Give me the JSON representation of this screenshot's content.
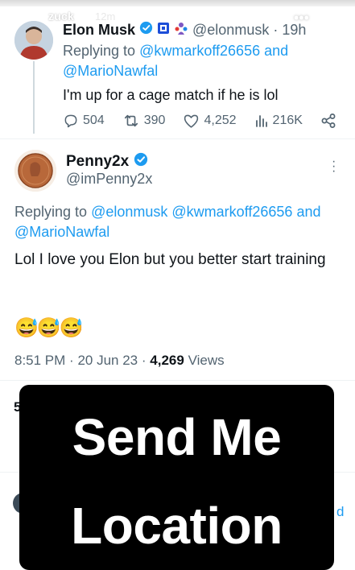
{
  "story": {
    "username": "zuck",
    "time": "12m"
  },
  "reply_tweet": {
    "name": "Elon Musk",
    "handle": "@elonmusk",
    "separator": "·",
    "age": "19h",
    "replying_prefix": "Replying to",
    "replying_handle_1": "@kwmarkoff26656",
    "replying_and": "and",
    "replying_handle_2": "@MarioNawfal",
    "text": "I'm up for a cage match if he is lol",
    "stats": {
      "replies": "504",
      "retweets": "390",
      "likes": "4,252",
      "views": "216K"
    }
  },
  "main_tweet": {
    "name": "Penny2x",
    "handle": "@imPenny2x",
    "replying_prefix": "Replying to",
    "replying_handle_1": "@elonmusk",
    "replying_handle_2": "@kwmarkoff26656",
    "replying_and": "and",
    "replying_handle_3": "@MarioNawfal",
    "text": "Lol I love you Elon but you better start training",
    "emojis": "😅😅😅",
    "time": "8:51 PM",
    "date": "20 Jun 23",
    "separator": "·",
    "views_count": "4,269",
    "views_label": "Views",
    "partial_stat": "5"
  },
  "overlay": {
    "line1": "Send Me",
    "line2": "Location"
  },
  "behind_overlay": {
    "partial_right": "d"
  },
  "colors": {
    "link": "#1d9bf0",
    "muted": "#536471",
    "verified": "#1d9bf0",
    "overlay_bg": "#000000"
  }
}
